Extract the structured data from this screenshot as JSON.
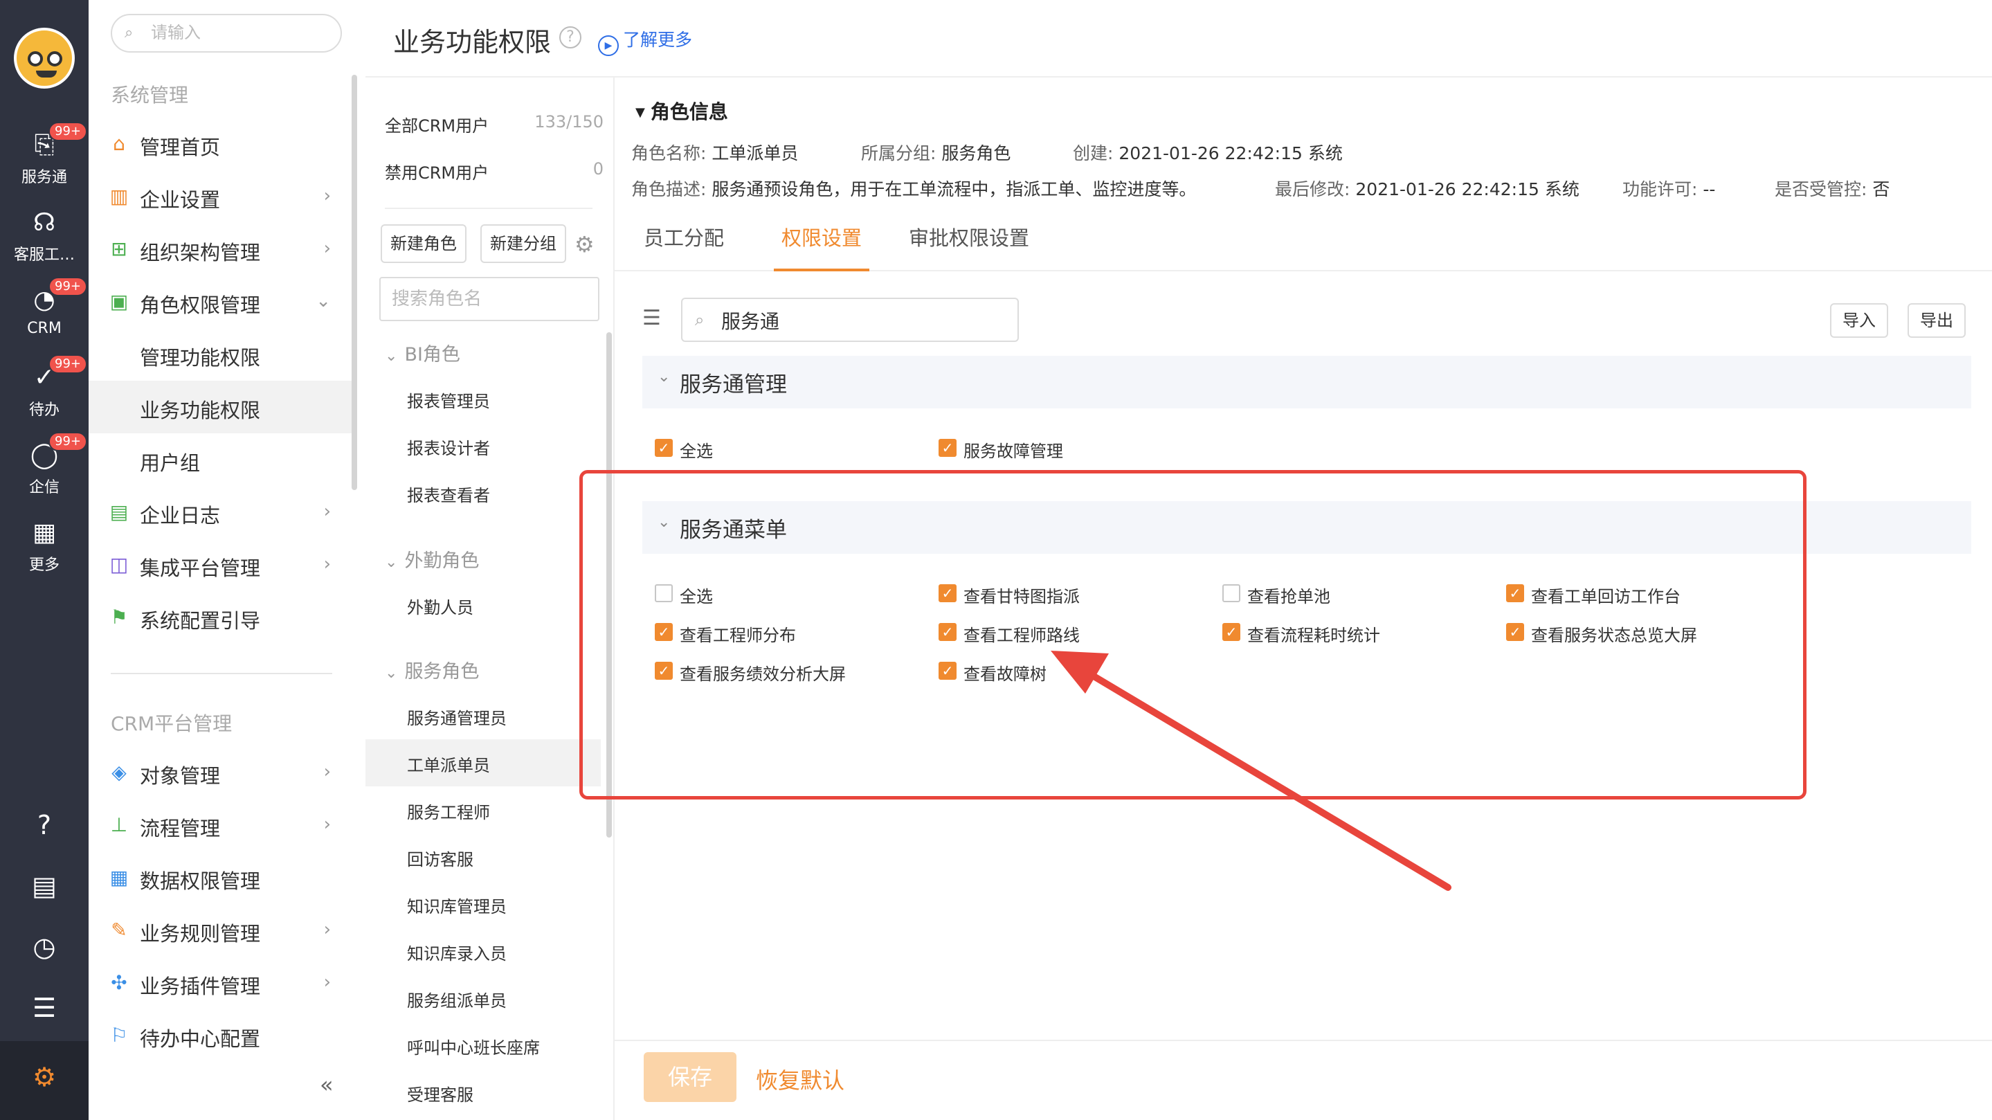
{
  "rail": {
    "items": [
      {
        "label": "服务通",
        "icon": "service-icon",
        "badge": "99+"
      },
      {
        "label": "客服工…",
        "icon": "headset-icon",
        "badge": ""
      },
      {
        "label": "CRM",
        "icon": "pie-chart-icon",
        "badge": "99+"
      },
      {
        "label": "待办",
        "icon": "check-circle-icon",
        "badge": "99+"
      },
      {
        "label": "企信",
        "icon": "chat-bubble-icon",
        "badge": "99+"
      },
      {
        "label": "更多",
        "icon": "grid-icon",
        "badge": ""
      }
    ],
    "bottom_icons": [
      "help-icon",
      "document-icon",
      "clock-icon",
      "user-list-icon",
      "gear-icon"
    ]
  },
  "sidebar": {
    "search_placeholder": "请输入",
    "section1_title": "系统管理",
    "items": [
      {
        "label": "管理首页",
        "icon": "home-icon",
        "arrow": ""
      },
      {
        "label": "企业设置",
        "icon": "building-icon",
        "arrow": "›"
      },
      {
        "label": "组织架构管理",
        "icon": "org-chart-icon",
        "arrow": "›"
      },
      {
        "label": "角色权限管理",
        "icon": "id-card-icon",
        "arrow": "⌄"
      },
      {
        "label": "管理功能权限",
        "icon": "",
        "arrow": ""
      },
      {
        "label": "业务功能权限",
        "icon": "",
        "arrow": ""
      },
      {
        "label": "用户组",
        "icon": "",
        "arrow": ""
      },
      {
        "label": "企业日志",
        "icon": "log-icon",
        "arrow": "›"
      },
      {
        "label": "集成平台管理",
        "icon": "chip-icon",
        "arrow": "›"
      },
      {
        "label": "系统配置引导",
        "icon": "signpost-icon",
        "arrow": ""
      }
    ],
    "section2_title": "CRM平台管理",
    "items2": [
      {
        "label": "对象管理",
        "icon": "cube-icon",
        "arrow": "›"
      },
      {
        "label": "流程管理",
        "icon": "flow-icon",
        "arrow": "›"
      },
      {
        "label": "数据权限管理",
        "icon": "data-lock-icon",
        "arrow": ""
      },
      {
        "label": "业务规则管理",
        "icon": "wrench-icon",
        "arrow": "›"
      },
      {
        "label": "业务插件管理",
        "icon": "puzzle-icon",
        "arrow": "›"
      },
      {
        "label": "待办中心配置",
        "icon": "flag-icon",
        "arrow": ""
      }
    ],
    "collapse_glyph": "«"
  },
  "header": {
    "title": "业务功能权限",
    "help_glyph": "?",
    "learn_more": "了解更多"
  },
  "rolelist": {
    "all_users_label": "全部CRM用户",
    "all_users_count": "133/150",
    "disabled_users_label": "禁用CRM用户",
    "disabled_users_count": "0",
    "new_role_btn": "新建角色",
    "new_group_btn": "新建分组",
    "search_placeholder": "搜索角色名",
    "groups": [
      {
        "name": "BI角色",
        "roles": [
          "报表管理员",
          "报表设计者",
          "报表查看者"
        ]
      },
      {
        "name": "外勤角色",
        "roles": [
          "外勤人员"
        ]
      },
      {
        "name": "服务角色",
        "roles": [
          "服务通管理员",
          "工单派单员",
          "服务工程师",
          "回访客服",
          "知识库管理员",
          "知识库录入员",
          "服务组派单员",
          "呼叫中心班长座席",
          "受理客服"
        ]
      }
    ],
    "active_role": "工单派单员"
  },
  "role_info": {
    "section_title": "角色信息",
    "name_key": "角色名称:",
    "name_val": "工单派单员",
    "group_key": "所属分组:",
    "group_val": "服务角色",
    "created_key": "创建:",
    "created_val": "2021-01-26 22:42:15 系统",
    "desc_key": "角色描述:",
    "desc_val": "服务通预设角色，用于在工单流程中，指派工单、监控进度等。",
    "modified_key": "最后修改:",
    "modified_val": "2021-01-26 22:42:15 系统",
    "license_key": "功能许可:",
    "license_val": "--",
    "controlled_key": "是否受管控:",
    "controlled_val": "否"
  },
  "tabs": [
    {
      "label": "员工分配",
      "active": false
    },
    {
      "label": "权限设置",
      "active": true
    },
    {
      "label": "审批权限设置",
      "active": false
    }
  ],
  "perm": {
    "search_value": "服务通",
    "import_btn": "导入",
    "export_btn": "导出",
    "groups": [
      {
        "title": "服务通管理",
        "items": [
          {
            "label": "全选",
            "checked": true
          },
          {
            "label": "服务故障管理",
            "checked": true
          }
        ]
      },
      {
        "title": "服务通菜单",
        "items": [
          {
            "label": "全选",
            "checked": false
          },
          {
            "label": "查看甘特图指派",
            "checked": true
          },
          {
            "label": "查看抢单池",
            "checked": false
          },
          {
            "label": "查看工单回访工作台",
            "checked": true
          },
          {
            "label": "查看工程师分布",
            "checked": true
          },
          {
            "label": "查看工程师路线",
            "checked": true
          },
          {
            "label": "查看流程耗时统计",
            "checked": true
          },
          {
            "label": "查看服务状态总览大屏",
            "checked": true
          },
          {
            "label": "查看服务绩效分析大屏",
            "checked": true
          },
          {
            "label": "查看故障树",
            "checked": true
          }
        ]
      }
    ]
  },
  "footer": {
    "save_btn": "保存",
    "reset_btn": "恢复默认"
  },
  "colors": {
    "accent": "#f08a2f",
    "rail_bg": "#2f3340",
    "badge": "#f0534c",
    "annotation_red": "#e8453c",
    "link_blue": "#2f6ee6"
  }
}
